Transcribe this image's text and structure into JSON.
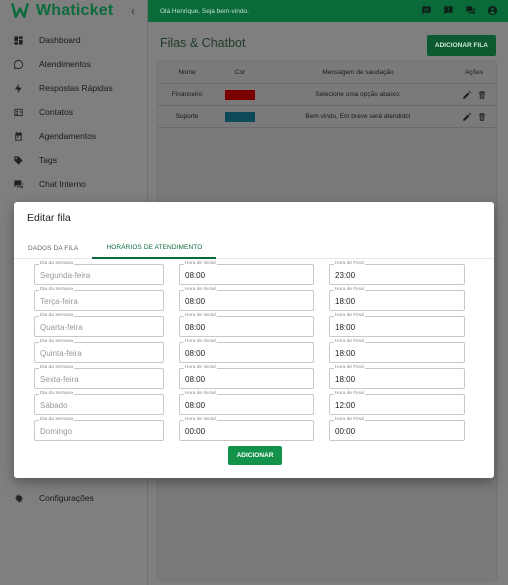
{
  "brand": {
    "name": "Whaticket",
    "collapse_icon": "‹"
  },
  "sidebar": {
    "items": [
      {
        "label": "Dashboard",
        "icon": "dashboard-icon"
      },
      {
        "label": "Atendimentos",
        "icon": "whatsapp-icon"
      },
      {
        "label": "Respostas Rápidas",
        "icon": "bolt-icon"
      },
      {
        "label": "Contatos",
        "icon": "contacts-icon"
      },
      {
        "label": "Agendamentos",
        "icon": "calendar-icon"
      },
      {
        "label": "Tags",
        "icon": "tag-icon"
      },
      {
        "label": "Chat Interno",
        "icon": "chat-icon"
      }
    ],
    "settings": {
      "label": "Configurações",
      "icon": "gear-icon"
    }
  },
  "topbar": {
    "greeting": "Olá Henrique, Seja bem-vindo."
  },
  "page": {
    "title": "Filas & Chatbot",
    "add_button": "ADICIONAR FILA"
  },
  "table": {
    "headers": {
      "name": "Nome",
      "color": "Cor",
      "message": "Mensagem de saudação",
      "actions": "Ações"
    },
    "rows": [
      {
        "name": "Financeiro",
        "color": "#7a0000",
        "message": "Selecione uma opção abaixo:"
      },
      {
        "name": "Suporte",
        "color": "#0b4a56",
        "message": "Bem vindo, Em breve será atendido!"
      }
    ]
  },
  "modal": {
    "title": "Editar fila",
    "tabs": [
      "DADOS DA FILA",
      "HORÁRIOS DE ATENDIMENTO"
    ],
    "active_tab": 1,
    "labels": {
      "day": "Dia da Semana",
      "start": "Hora de Inicial",
      "end": "Hora de Final"
    },
    "schedule": [
      {
        "day": "Segunda-feira",
        "start": "08:00",
        "end": "23:00"
      },
      {
        "day": "Terça-feira",
        "start": "08:00",
        "end": "18:00"
      },
      {
        "day": "Quarta-feira",
        "start": "08:00",
        "end": "18:00"
      },
      {
        "day": "Quinta-feira",
        "start": "08:00",
        "end": "18:00"
      },
      {
        "day": "Sexta-feira",
        "start": "08:00",
        "end": "18:00"
      },
      {
        "day": "Sábado",
        "start": "08:00",
        "end": "12:00"
      },
      {
        "day": "Domingo",
        "start": "00:00",
        "end": "00:00"
      }
    ],
    "add_button": "ADICIONAR"
  },
  "colors": {
    "brand_green": "#0a6a39",
    "button_green": "#13934a"
  }
}
